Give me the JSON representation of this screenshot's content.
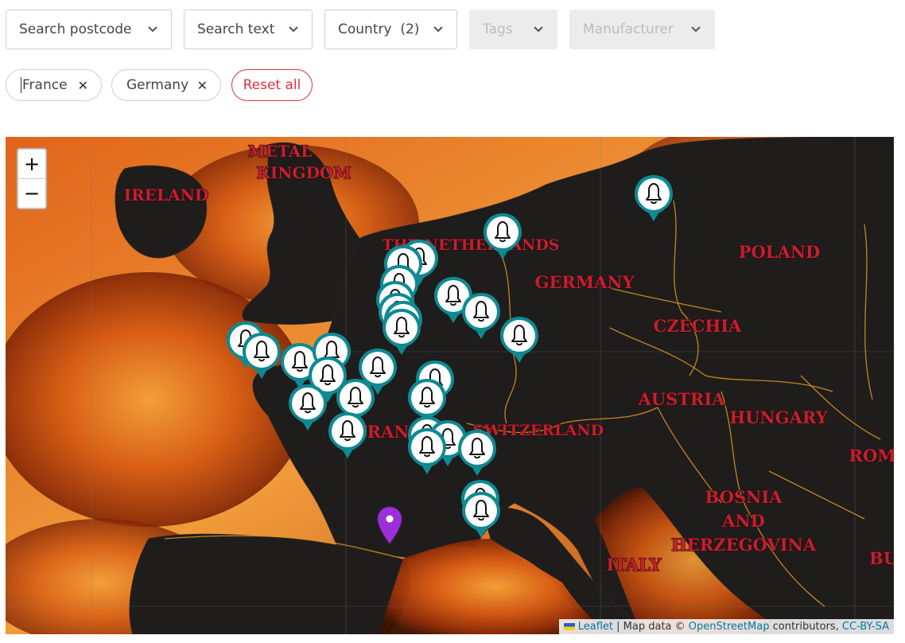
{
  "filters": {
    "postcode": "Search postcode",
    "text": "Search text",
    "country": "Country  (2)",
    "tags": "Tags",
    "manufacturer": "Manufacturer"
  },
  "chips": [
    {
      "label": "France"
    },
    {
      "label": "Germany"
    }
  ],
  "reset_label": "Reset all",
  "zoom": {
    "in": "+",
    "out": "−"
  },
  "map_labels": {
    "metal_kingdom_1": "METAL",
    "metal_kingdom_2": "KINGDOM",
    "ireland": "IRELAND",
    "netherlands": "THE NETHERLANDS",
    "germany": "GERMANY",
    "poland": "POLAND",
    "czechia": "CZECHIA",
    "austria": "AUSTRIA",
    "hungary": "HUNGARY",
    "switzerland": "SWITZERLAND",
    "france": "FRANCE",
    "bosnia_1": "BOSNIA",
    "bosnia_2": "AND",
    "bosnia_3": "HERZEGOVINA",
    "italy": "ITALY",
    "romania": "ROM",
    "bulgaria": "BU"
  },
  "attribution": {
    "leaflet": "Leaflet",
    "sep": " | Map data © ",
    "osm": "OpenStreetMap",
    "contrib": " contributors, ",
    "license": "CC-BY-SA"
  },
  "marker_icon": "bell-icon",
  "location_icon": "map-pin-icon",
  "colors": {
    "marker_teal": "#0e8a93",
    "location_pin": "#9b30d9",
    "reset_red": "#d9363e",
    "label_red": "#c81e2e"
  }
}
